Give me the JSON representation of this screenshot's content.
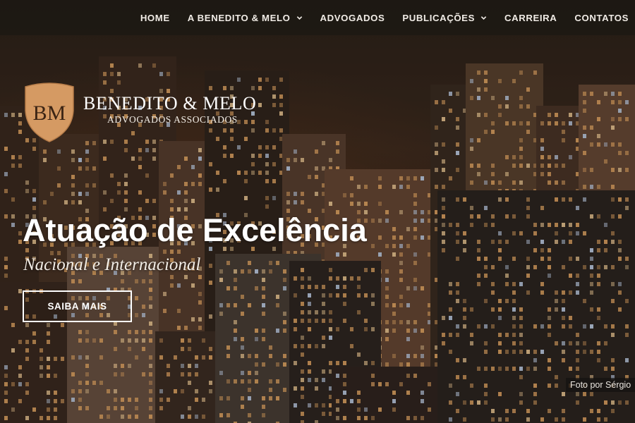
{
  "nav": {
    "items": [
      {
        "label": "HOME",
        "has_dropdown": false
      },
      {
        "label": "A BENEDITO & MELO",
        "has_dropdown": true
      },
      {
        "label": "ADVOGADOS",
        "has_dropdown": false
      },
      {
        "label": "PUBLICAÇÕES",
        "has_dropdown": true
      },
      {
        "label": "CARREIRA",
        "has_dropdown": false
      },
      {
        "label": "CONTATOS",
        "has_dropdown": false
      }
    ],
    "dropdown_icon": "chevron-down-icon"
  },
  "logo": {
    "monogram": "BM",
    "name": "BENEDITO & MELO",
    "subtitle": "ADVOGADOS ASSOCIADOS",
    "crest_color": "#d59a63",
    "monogram_color": "#3b2414"
  },
  "hero": {
    "title": "Atuação de Excelência",
    "subtitle": "Nacional e Internacional",
    "cta_label": "SAIBA MAIS",
    "background_image": "night city skyline with lit skyscrapers"
  },
  "photo_credit": "Foto por Sérgio"
}
